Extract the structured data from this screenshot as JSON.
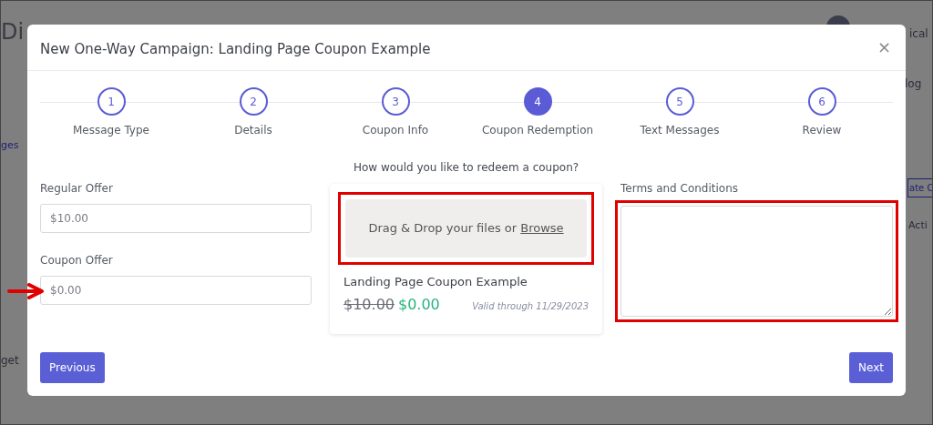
{
  "background": {
    "fragments": [
      {
        "kind": "heading",
        "text": "Di"
      },
      {
        "kind": "user",
        "text": "ical"
      },
      {
        "kind": "tab",
        "text": "log"
      },
      {
        "kind": "link",
        "text": "ges"
      },
      {
        "kind": "button",
        "text": "ate C"
      },
      {
        "kind": "column",
        "text": "Acti"
      },
      {
        "kind": "menu",
        "text": "get"
      }
    ]
  },
  "modal": {
    "title": "New One-Way Campaign: Landing Page Coupon Example",
    "close": "×",
    "steps": [
      {
        "number": "1",
        "label": "Message Type",
        "selected": false
      },
      {
        "number": "2",
        "label": "Details",
        "selected": false
      },
      {
        "number": "3",
        "label": "Coupon Info",
        "selected": false
      },
      {
        "number": "4",
        "label": "Coupon Redemption",
        "selected": true
      },
      {
        "number": "5",
        "label": "Text Messages",
        "selected": false
      },
      {
        "number": "6",
        "label": "Review",
        "selected": false
      }
    ],
    "fields": [
      {
        "label": "Regular Offer",
        "placeholder": "$10.00",
        "pointed": false
      },
      {
        "label": "Coupon Offer",
        "placeholder": "$0.00",
        "pointed": true
      }
    ],
    "redeem": {
      "question": "How would you like to redeem a coupon?",
      "dropzone": {
        "text": "Drag & Drop your files or ",
        "link": "Browse",
        "highlighted": true
      },
      "coupon": {
        "title": "Landing Page Coupon Example",
        "regular_price": "$10.00",
        "coupon_price": "$0.00",
        "validity": "Valid through 11/29/2023"
      }
    },
    "terms": {
      "label": "Terms and Conditions",
      "highlighted": true
    },
    "buttons": {
      "previous": "Previous",
      "next": "Next"
    }
  }
}
